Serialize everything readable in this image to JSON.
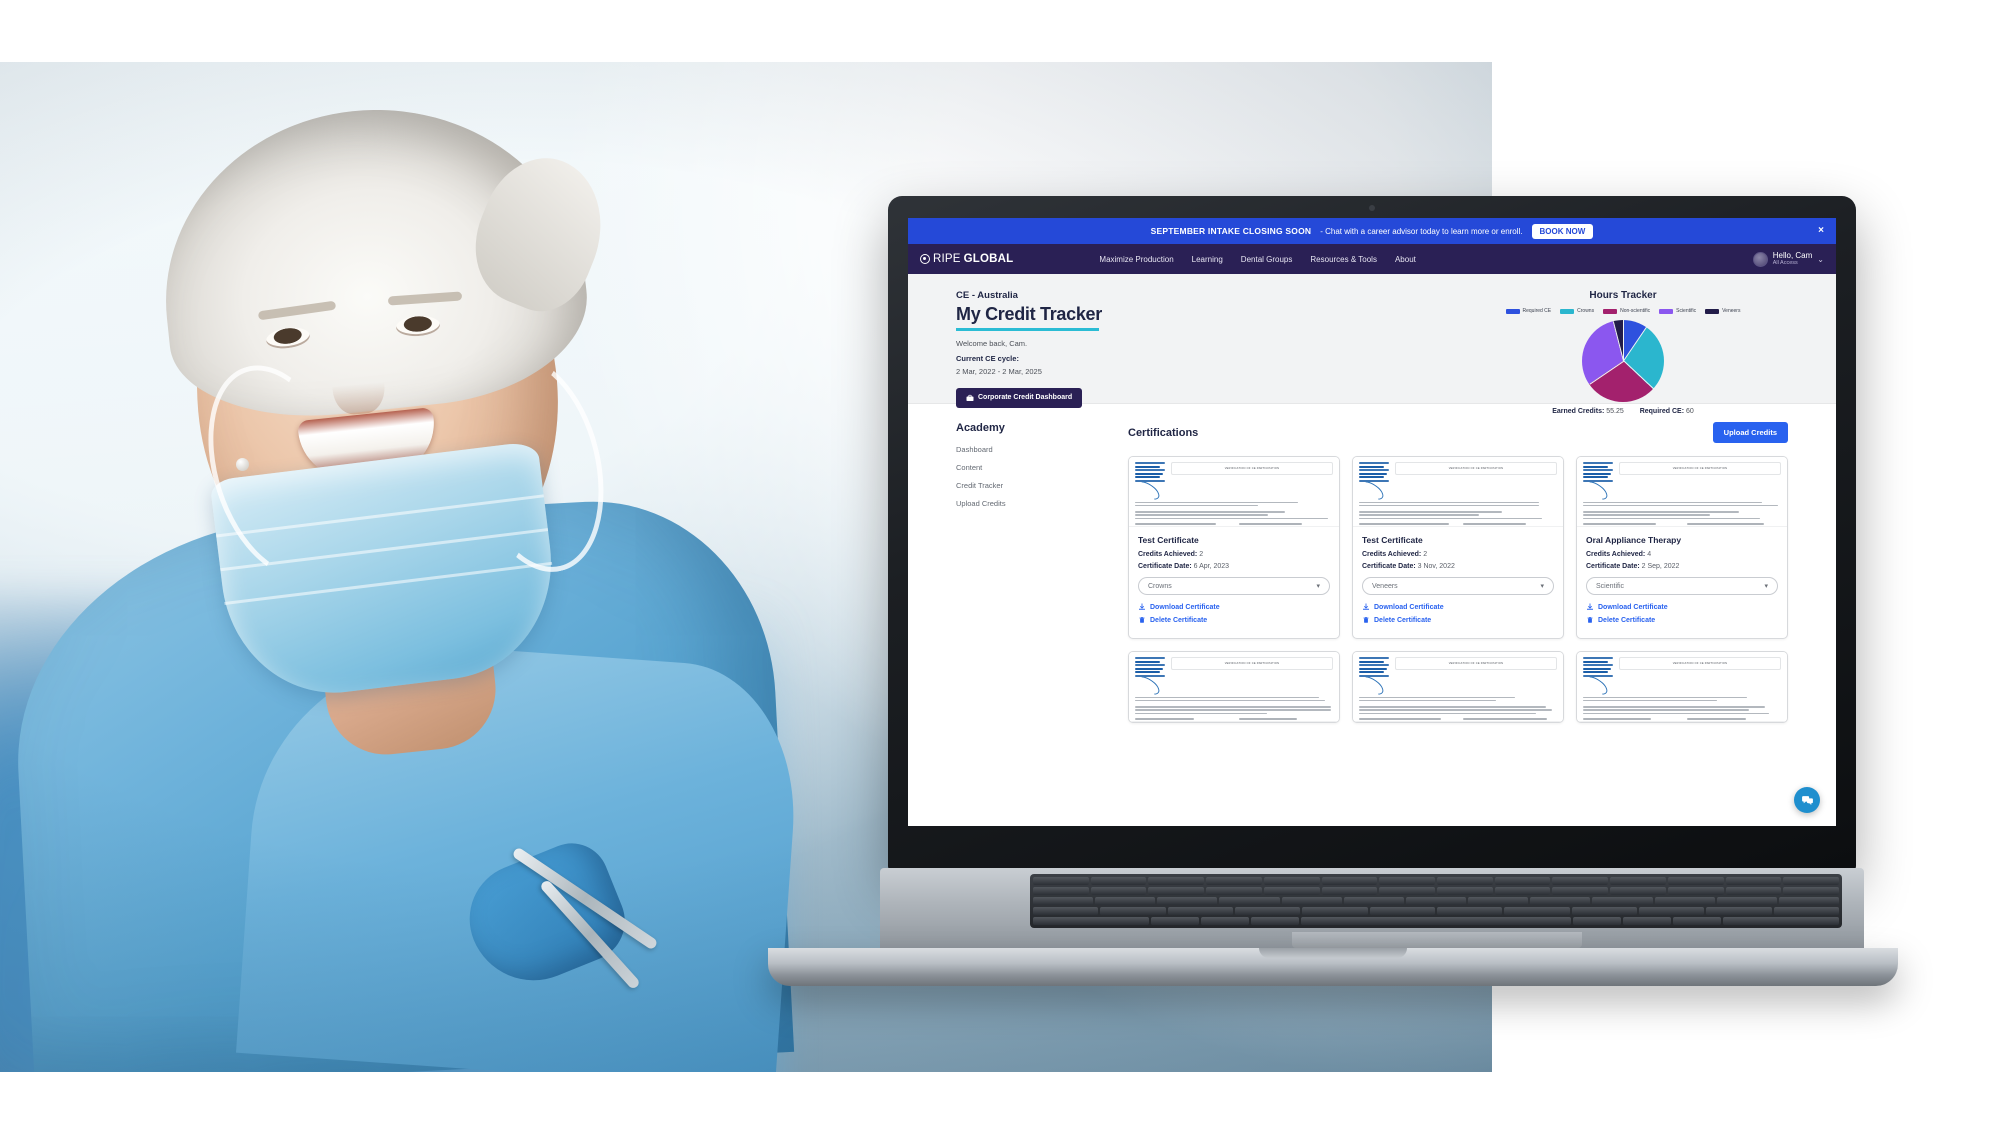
{
  "promo": {
    "strong": "SEPTEMBER INTAKE CLOSING SOON",
    "text": "- Chat with a career advisor today to learn more or enroll.",
    "button": "BOOK NOW",
    "close": "×",
    "bg": "#2549d8"
  },
  "nav": {
    "logo_light": "RIPE",
    "logo_bold": "GLOBAL",
    "links": [
      {
        "label": "Maximize Production"
      },
      {
        "label": "Learning"
      },
      {
        "label": "Dental Groups"
      },
      {
        "label": "Resources & Tools"
      },
      {
        "label": "About"
      }
    ],
    "user_name": "Hello, Cam",
    "user_plan": "All Access",
    "chevron": "⌄",
    "bg": "#2a2055"
  },
  "hero": {
    "eyebrow": "CE - Australia",
    "title": "My Credit Tracker",
    "rule_color": "#2bbcd4",
    "welcome": "Welcome back, Cam.",
    "cycle_label": "Current CE cycle:",
    "cycle_value": "2 Mar, 2022 - 2 Mar, 2025",
    "corporate_button": "Corporate Credit Dashboard"
  },
  "chart_data": {
    "type": "pie",
    "title": "Hours Tracker",
    "categories": [
      "Required CE",
      "Crowns",
      "Non-scientific",
      "Scientific",
      "Veneers"
    ],
    "values": [
      9.5,
      27.5,
      28.5,
      30.5,
      4.0
    ],
    "colors": [
      "#2e51de",
      "#2bb6ce",
      "#a3216d",
      "#8b57ef",
      "#221c49"
    ],
    "legend_position": "top",
    "grid": false,
    "footer": {
      "earned_label": "Earned Credits:",
      "earned_value": "55.25",
      "required_label": "Required CE:",
      "required_value": "60"
    }
  },
  "academy": {
    "heading": "Academy",
    "items": [
      {
        "label": "Dashboard"
      },
      {
        "label": "Content"
      },
      {
        "label": "Credit Tracker"
      },
      {
        "label": "Upload Credits"
      }
    ]
  },
  "certifications": {
    "heading": "Certifications",
    "upload_button": "Upload Credits",
    "labels": {
      "credits": "Credits Achieved:",
      "date": "Certificate Date:",
      "download": "Download Certificate",
      "delete": "Delete Certificate"
    },
    "thumb_banner": "VERIFICATION OF CE PARTICIPATION",
    "cards": [
      {
        "title": "Test Certificate",
        "credits": "2",
        "date": "6 Apr, 2023",
        "category": "Crowns"
      },
      {
        "title": "Test Certificate",
        "credits": "2",
        "date": "3 Nov, 2022",
        "category": "Veneers"
      },
      {
        "title": "Oral Appliance Therapy",
        "credits": "4",
        "date": "2 Sep, 2022",
        "category": "Scientific"
      }
    ],
    "cards_row2": [
      {
        "title": "",
        "credits": "",
        "date": "",
        "category": ""
      },
      {
        "title": "",
        "credits": "",
        "date": "",
        "category": ""
      },
      {
        "title": "",
        "credits": "",
        "date": "",
        "category": ""
      }
    ]
  },
  "chat": {
    "icon": "chat-icon"
  }
}
